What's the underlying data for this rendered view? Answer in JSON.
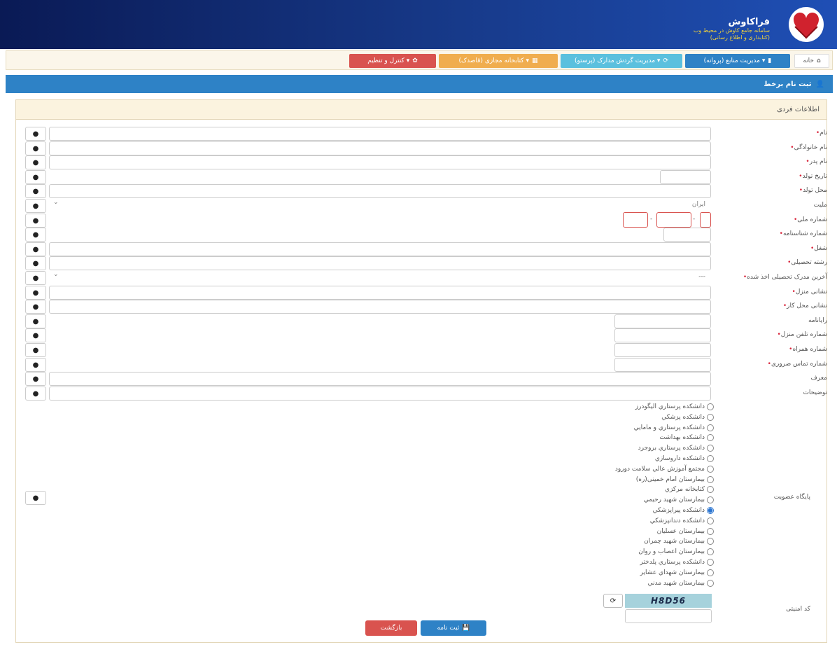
{
  "header": {
    "app_name": "فراکاوش",
    "tagline1": "سامانه جامع کاوش در محیط وب",
    "tagline2": "(کتابداری و اطلاع رسانی)"
  },
  "nav": {
    "home": "خانه",
    "m1": "مدیریت منابع (پروانه) ▾",
    "m2": "مدیریت گردش مدارک (پرستو) ▾",
    "m3": "کتابخانه مجازی (قاصدک) ▾",
    "m4": "کنترل و تنظیم ▾"
  },
  "page": {
    "title": "ثبت نام برخط",
    "section": "اطلاعات فردی"
  },
  "form": {
    "req_mark": "•",
    "help_glyph": "❓",
    "fields": [
      {
        "label": "نام",
        "required": true
      },
      {
        "label": "نام خانوادگی",
        "required": true
      },
      {
        "label": "نام پدر",
        "required": true
      },
      {
        "label": "تاریخ تولد",
        "required": true
      },
      {
        "label": "محل تولد",
        "required": true
      },
      {
        "label": "ملیت",
        "required": false,
        "value": "ایران"
      },
      {
        "label": "شماره ملی",
        "required": true
      },
      {
        "label": "شماره شناسنامه",
        "required": true
      },
      {
        "label": "شغل",
        "required": true
      },
      {
        "label": "رشته تحصیلی",
        "required": true
      },
      {
        "label": "آخرین مدرک تحصیلی اخذ شده",
        "required": true,
        "value": "---"
      },
      {
        "label": "نشانی منزل",
        "required": true
      },
      {
        "label": "نشانی محل کار",
        "required": true
      },
      {
        "label": "رایانامه",
        "required": false
      },
      {
        "label": "شماره تلفن منزل",
        "required": true
      },
      {
        "label": "شماره همراه",
        "required": true
      },
      {
        "label": "شماره تماس ضروری",
        "required": true
      },
      {
        "label": "معرف",
        "required": false
      },
      {
        "label": "توضیحات",
        "required": false
      }
    ],
    "membership_label": "پایگاه عضویت",
    "membership_options": [
      "دانشکده پرستاري اليگودرز",
      "دانشکده پزشکي",
      "دانشکده پرستاري و مامايي",
      "دانشکده بهداشت",
      "دانشکده پرستاري بروجرد",
      "دانشکده داروسازي",
      "مجتمع آموزش عالي سلامت دورود",
      "بیمارستان امام خمینی(ره)",
      "کتابخانه مرکزي",
      "بیمارستان شهيد رحيمي",
      "دانشکده پيراپزشکي",
      "دانشکده دندانپزشکي",
      "بیمارستان عسليان",
      "بیمارستان شهيد چمران",
      "بیمارستان اعصاب و روان",
      "دانشکده پرستاري پلدختر",
      "بیمارستان شهداي عشاير",
      "بیمارستان شهيد مدني"
    ],
    "membership_selected": 10,
    "captcha_label": "کد امنیتی",
    "captcha_text": "H8D56"
  },
  "actions": {
    "submit": "ثبت نامه",
    "back": "بازگشت"
  },
  "colors": {
    "banner": "#173a8a",
    "nav_blue": "#2e82c6",
    "nav_teal": "#5bc0de",
    "nav_orange": "#f0ad4e",
    "nav_red": "#d9534f",
    "required": "#d9253b"
  }
}
